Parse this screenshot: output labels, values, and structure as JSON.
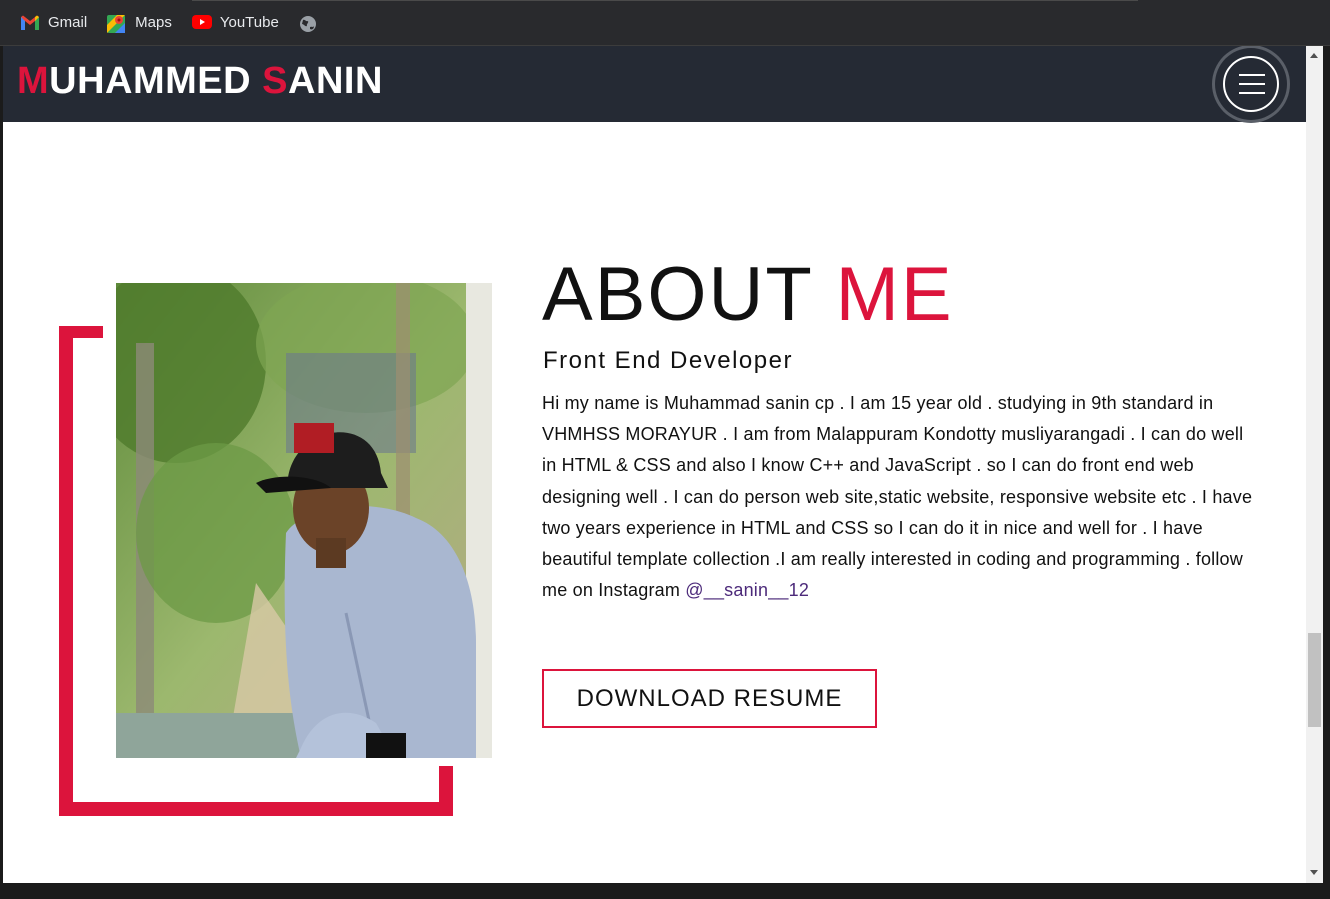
{
  "bookmarks": [
    {
      "label": "Gmail",
      "icon": "gmail-icon"
    },
    {
      "label": "Maps",
      "icon": "maps-icon"
    },
    {
      "label": "YouTube",
      "icon": "youtube-icon"
    },
    {
      "label": "",
      "icon": "globe-icon"
    }
  ],
  "navbar": {
    "brand_first_initial": "M",
    "brand_first_rest": "UHAMMED ",
    "brand_last_initial": "S",
    "brand_last_rest": "ANIN",
    "menu_icon": "hamburger-menu-icon"
  },
  "about": {
    "title_main": "ABOUT ",
    "title_accent": "ME",
    "subtitle": "Front End Developer",
    "bio": "Hi my name is Muhammad sanin cp . I am 15 year old . studying in 9th standard in VHMHSS MORAYUR . I am from Malappuram Kondotty musliyarangadi . I can do well in HTML & CSS and also I know C++ and JavaScript . so I can do front end web designing well . I can do person web site,static website, responsive website etc . I have two years experience in HTML and CSS so I can do it in nice and well for . I have beautiful template collection .I am really interested in coding and programming . follow me on Instagram ",
    "instagram_handle": "@__sanin__12",
    "resume_button": "DOWNLOAD RESUME"
  },
  "colors": {
    "accent": "#dc143c",
    "navbar_bg": "#252a34",
    "link": "#4c2a7a"
  }
}
